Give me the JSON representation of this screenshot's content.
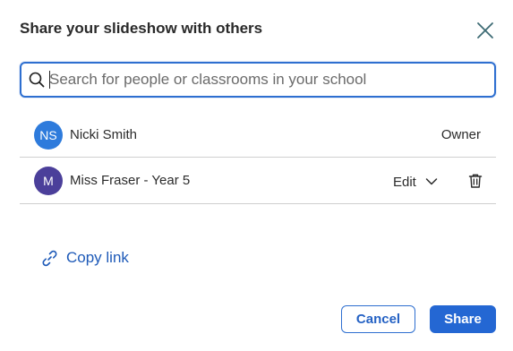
{
  "dialog": {
    "title": "Share your slideshow with others"
  },
  "search": {
    "placeholder": "Search for people or classrooms in your school",
    "value": ""
  },
  "people": [
    {
      "initials": "NS",
      "name": "Nicki Smith",
      "role": "Owner",
      "avatar_color": "#2e7bdc"
    },
    {
      "initials": "M",
      "name": "Miss Fraser - Year 5",
      "role": "Edit",
      "avatar_color": "#4b3f9a"
    }
  ],
  "copy_link": {
    "label": "Copy link"
  },
  "actions": {
    "cancel_label": "Cancel",
    "share_label": "Share"
  },
  "colors": {
    "accent": "#2467d3",
    "link": "#1e5ab8",
    "divider": "#cfcfcf"
  }
}
